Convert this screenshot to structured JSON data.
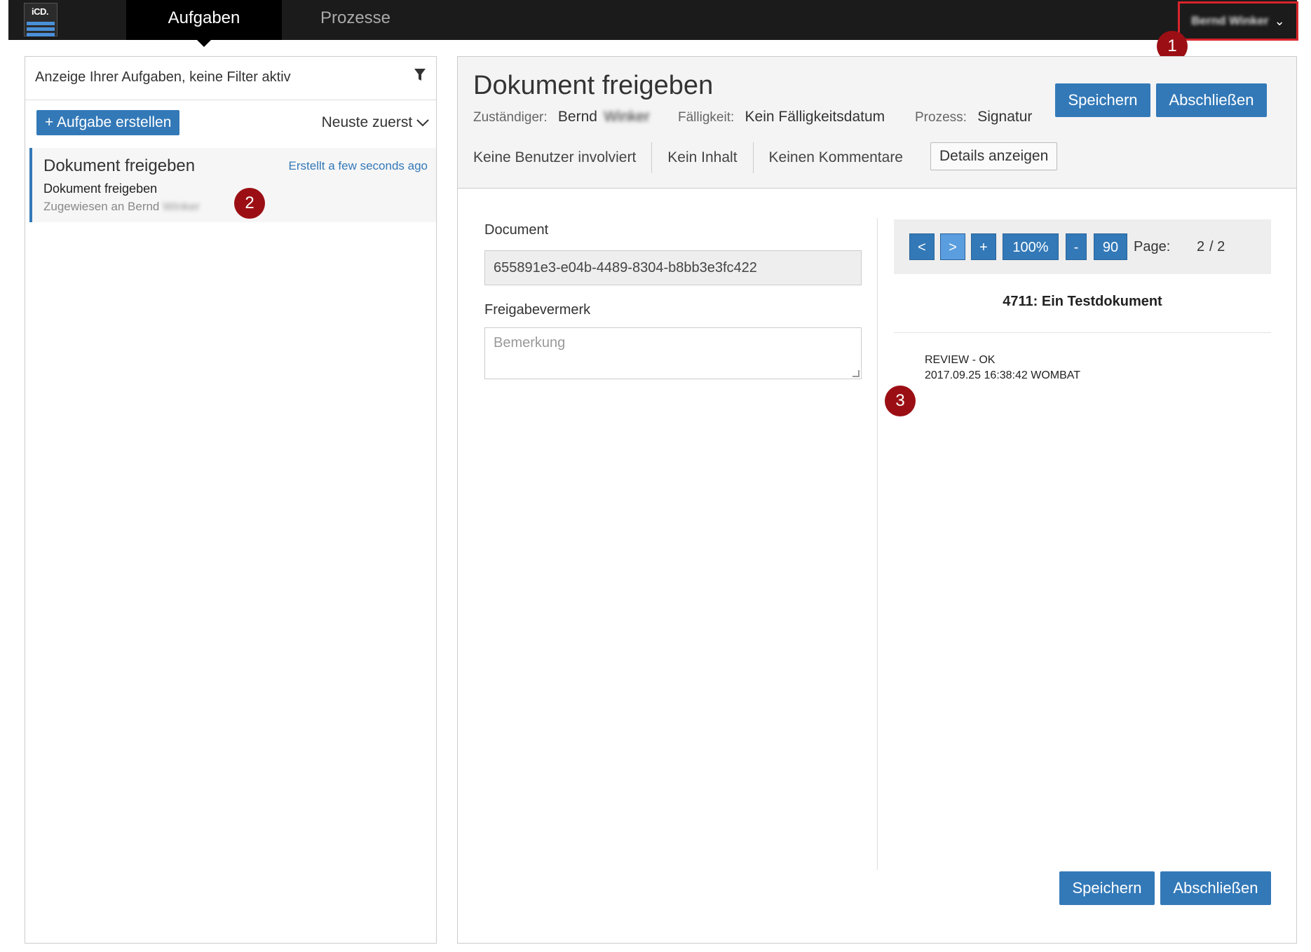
{
  "topbar": {
    "logo_text": "iCD.",
    "tabs": [
      {
        "label": "Aufgaben",
        "active": true
      },
      {
        "label": "Prozesse",
        "active": false
      }
    ],
    "user_name": "Bernd Winker"
  },
  "markers": [
    "1",
    "2",
    "3"
  ],
  "left": {
    "filter_text": "Anzeige Ihrer Aufgaben, keine Filter aktiv",
    "create_button": "+ Aufgabe erstellen",
    "sort_label": "Neuste zuerst",
    "task": {
      "title": "Dokument freigeben",
      "created": "Erstellt a few seconds ago",
      "subtitle": "Dokument freigeben",
      "assigned_prefix": "Zugewiesen an Bernd",
      "assigned_surname": "Winker"
    }
  },
  "right": {
    "title": "Dokument freigeben",
    "save_label": "Speichern",
    "complete_label": "Abschließen",
    "meta": {
      "assignee_label": "Zuständiger:",
      "assignee_first": "Bernd",
      "assignee_surname": "Winker",
      "due_label": "Fälligkeit:",
      "due_value": "Kein Fälligkeitsdatum",
      "process_label": "Prozess:",
      "process_value": "Signatur"
    },
    "tabs": [
      "Keine Benutzer involviert",
      "Kein Inhalt",
      "Keinen Kommentare"
    ],
    "details_button": "Details anzeigen",
    "document_label": "Document",
    "document_value": "655891e3-e04b-4489-8304-b8bb3e3fc422",
    "remark_label": "Freigabevermerk",
    "remark_placeholder": "Bemerkung",
    "viewer": {
      "prev": "<",
      "next": ">",
      "zoom_in": "+",
      "zoom": "100%",
      "zoom_out": "-",
      "rotate": "90",
      "page_label": "Page:",
      "page_current": "2",
      "page_total": "/ 2",
      "doc_title": "4711: Ein Testdokument",
      "stamp_line1": "REVIEW - OK",
      "stamp_line2": "2017.09.25 16:38:42 WOMBAT"
    }
  },
  "colors": {
    "accent": "#3379b8",
    "marker": "#9b0f14",
    "topbar": "#1b1b1b",
    "highlight": "#d9242b"
  }
}
